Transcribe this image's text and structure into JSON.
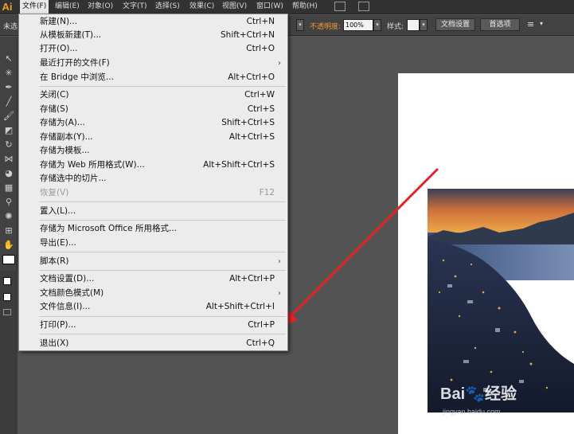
{
  "app": {
    "logo": "Ai"
  },
  "menubar": {
    "items": [
      "文件(F)",
      "编辑(E)",
      "对象(O)",
      "文字(T)",
      "选择(S)",
      "效果(C)",
      "视图(V)",
      "窗口(W)",
      "帮助(H)"
    ]
  },
  "control_bar": {
    "left_label": "未选",
    "opacity_label": "不透明度:",
    "opacity_value": "100%",
    "style_label": "样式:",
    "doc_setup_button": "文档设置",
    "prefs_button": "首选项"
  },
  "file_menu": {
    "items": [
      {
        "label": "新建(N)...",
        "shortcut": "Ctrl+N"
      },
      {
        "label": "从模板新建(T)...",
        "shortcut": "Shift+Ctrl+N"
      },
      {
        "label": "打开(O)...",
        "shortcut": "Ctrl+O"
      },
      {
        "label": "最近打开的文件(F)",
        "submenu": "›"
      },
      {
        "label": "在 Bridge 中浏览...",
        "shortcut": "Alt+Ctrl+O"
      },
      {
        "label": "关闭(C)",
        "shortcut": "Ctrl+W"
      },
      {
        "label": "存储(S)",
        "shortcut": "Ctrl+S"
      },
      {
        "label": "存储为(A)...",
        "shortcut": "Shift+Ctrl+S"
      },
      {
        "label": "存储副本(Y)...",
        "shortcut": "Alt+Ctrl+S"
      },
      {
        "label": "存储为模板..."
      },
      {
        "label": "存储为 Web 所用格式(W)...",
        "shortcut": "Alt+Shift+Ctrl+S"
      },
      {
        "label": "存储选中的切片..."
      },
      {
        "label": "恢复(V)",
        "shortcut": "F12"
      },
      {
        "label": "置入(L)..."
      },
      {
        "label": "存储为 Microsoft Office 所用格式..."
      },
      {
        "label": "导出(E)..."
      },
      {
        "label": "脚本(R)",
        "submenu": "›"
      },
      {
        "label": "文档设置(D)...",
        "shortcut": "Alt+Ctrl+P"
      },
      {
        "label": "文档颜色模式(M)",
        "submenu": "›"
      },
      {
        "label": "文件信息(I)...",
        "shortcut": "Alt+Shift+Ctrl+I"
      },
      {
        "label": "打印(P)...",
        "shortcut": "Ctrl+P"
      },
      {
        "label": "退出(X)",
        "shortcut": "Ctrl+Q"
      }
    ]
  },
  "watermark": {
    "brand": "Bai🐾经验",
    "url": "jingyan.baidu.com"
  },
  "colors": {
    "accent_arrow": "#e8202a",
    "menu_bg": "#ececec",
    "ui_bg": "#535353"
  }
}
